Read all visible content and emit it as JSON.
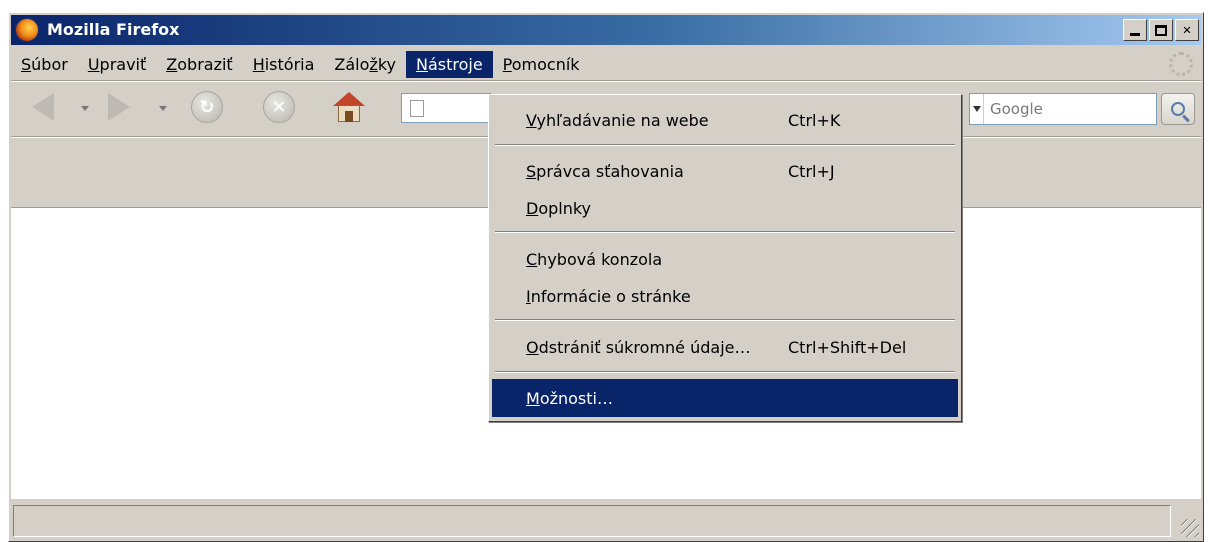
{
  "window": {
    "title": "Mozilla Firefox"
  },
  "menubar": {
    "items": [
      {
        "pre": "",
        "u": "S",
        "post": "úbor"
      },
      {
        "pre": "",
        "u": "U",
        "post": "praviť"
      },
      {
        "pre": "",
        "u": "Z",
        "post": "obraziť"
      },
      {
        "pre": "",
        "u": "H",
        "post": "istória"
      },
      {
        "pre": "Zálo",
        "u": "ž",
        "post": "ky"
      },
      {
        "pre": "",
        "u": "N",
        "post": "ástroje"
      },
      {
        "pre": "",
        "u": "P",
        "post": "omocník"
      }
    ],
    "active_index": 5
  },
  "search": {
    "engine": "Google"
  },
  "tools_menu": {
    "items": [
      {
        "pre": "",
        "u": "V",
        "post": "yhľadávanie na webe",
        "shortcut": "Ctrl+K"
      },
      {
        "pre": "",
        "u": "S",
        "post": "právca sťahovania",
        "shortcut": "Ctrl+J"
      },
      {
        "pre": "",
        "u": "D",
        "post": "oplnky",
        "shortcut": ""
      },
      {
        "pre": "",
        "u": "C",
        "post": "hybová konzola",
        "shortcut": ""
      },
      {
        "pre": "",
        "u": "I",
        "post": "nformácie o stránke",
        "shortcut": ""
      },
      {
        "pre": "",
        "u": "O",
        "post": "dstrániť súkromné údaje…",
        "shortcut": "Ctrl+Shift+Del"
      },
      {
        "pre": "",
        "u": "M",
        "post": "ožnosti…",
        "shortcut": ""
      }
    ],
    "selected_index": 6
  }
}
